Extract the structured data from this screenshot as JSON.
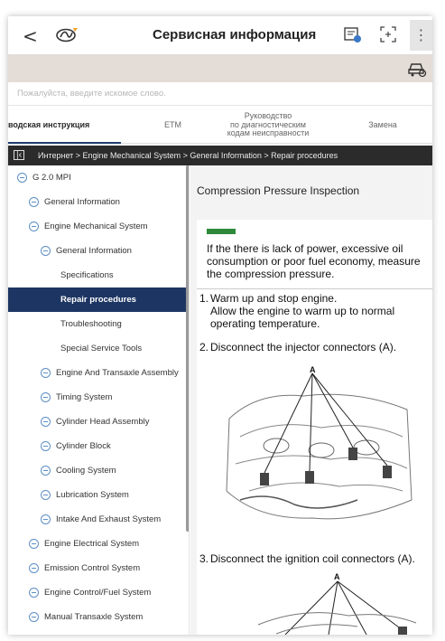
{
  "header": {
    "back_glyph": "<",
    "title": "Сервисная информация",
    "menu_glyph": "⋮"
  },
  "search": {
    "placeholder": "Пожалуйста, введите искомое слово."
  },
  "tabs": [
    {
      "label": "водская инструкция",
      "active": true
    },
    {
      "label": "ETM",
      "active": false
    },
    {
      "label": "Руководство\nпо диагностическим\nкодам неисправности",
      "active": false
    },
    {
      "label": "Замена",
      "active": false
    }
  ],
  "breadcrumb": {
    "text": "Интернет > Engine Mechanical System > General Information > Repair procedures"
  },
  "tree": {
    "items": [
      {
        "label": "G 2.0 MPI",
        "icon": true,
        "selected": false
      },
      {
        "label": "General Information",
        "icon": true,
        "selected": false
      },
      {
        "label": "Engine Mechanical System",
        "icon": true,
        "selected": false
      },
      {
        "label": "General Information",
        "icon": true,
        "selected": false
      },
      {
        "label": "Specifications",
        "icon": false,
        "selected": false
      },
      {
        "label": "Repair procedures",
        "icon": false,
        "selected": true
      },
      {
        "label": "Troubleshooting",
        "icon": false,
        "selected": false
      },
      {
        "label": "Special Service Tools",
        "icon": false,
        "selected": false
      },
      {
        "label": "Engine And Transaxle Assembly",
        "icon": true,
        "selected": false
      },
      {
        "label": "Timing System",
        "icon": true,
        "selected": false
      },
      {
        "label": "Cylinder Head Assembly",
        "icon": true,
        "selected": false
      },
      {
        "label": "Cylinder Block",
        "icon": true,
        "selected": false
      },
      {
        "label": "Cooling System",
        "icon": true,
        "selected": false
      },
      {
        "label": "Lubrication System",
        "icon": true,
        "selected": false
      },
      {
        "label": "Intake And Exhaust System",
        "icon": true,
        "selected": false
      },
      {
        "label": "Engine Electrical System",
        "icon": true,
        "selected": false
      },
      {
        "label": "Emission Control System",
        "icon": true,
        "selected": false
      },
      {
        "label": "Engine Control/Fuel System",
        "icon": true,
        "selected": false
      },
      {
        "label": "Manual Transaxle System",
        "icon": true,
        "selected": false
      }
    ]
  },
  "doc": {
    "title": "Compression Pressure Inspection",
    "note": "If the there is lack of power, excessive oil consumption or poor fuel economy, measure the compression pressure.",
    "steps": [
      {
        "num": "1.",
        "text": "Warm up and stop engine.\nAllow the engine to warm up to normal operating temperature."
      },
      {
        "num": "2.",
        "text": "Disconnect the injector connectors (A)."
      },
      {
        "num": "3.",
        "text": "Disconnect the ignition coil connectors (A)."
      }
    ],
    "figure_label_1": "A",
    "figure_label_2": "A"
  },
  "colors": {
    "nav_selected": "#1d3562",
    "breadcrumb_bg": "#2b2b2b",
    "banner_bg": "#e4dcd6",
    "tree_icon": "#5d8fc6",
    "note_badge": "#2e8a3a"
  }
}
